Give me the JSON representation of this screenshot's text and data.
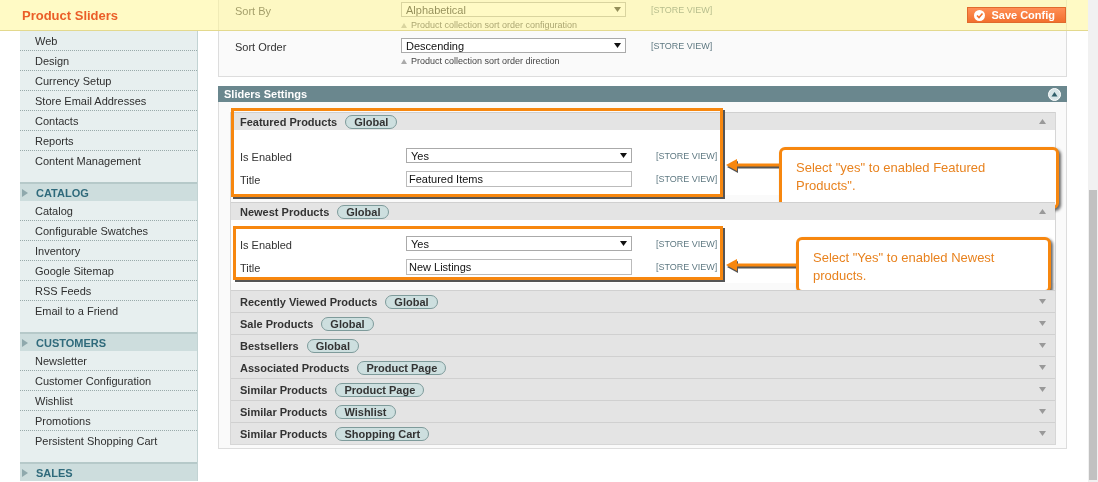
{
  "header": {
    "title": "Product Sliders",
    "save_button": "Save Config"
  },
  "sidebar": {
    "groups": [
      {
        "items": [
          "Web",
          "Design",
          "Currency Setup",
          "Store Email Addresses",
          "Contacts",
          "Reports",
          "Content Management"
        ]
      },
      {
        "title": "CATALOG",
        "items": [
          "Catalog",
          "Configurable Swatches",
          "Inventory",
          "Google Sitemap",
          "RSS Feeds",
          "Email to a Friend"
        ]
      },
      {
        "title": "CUSTOMERS",
        "items": [
          "Newsletter",
          "Customer Configuration",
          "Wishlist",
          "Promotions",
          "Persistent Shopping Cart"
        ]
      },
      {
        "title": "SALES"
      }
    ]
  },
  "general_fields": [
    {
      "label": "Sort By",
      "value": "Alphabetical",
      "note": "Product collection sort order configuration",
      "scope": "[STORE VIEW]"
    },
    {
      "label": "Sort Order",
      "value": "Descending",
      "note": "Product collection sort order direction",
      "scope": "[STORE VIEW]"
    }
  ],
  "sliders_section": {
    "title": "Sliders Settings",
    "expanded": true,
    "groups": [
      {
        "title": "Featured Products",
        "scope": "Global",
        "expanded": true,
        "fields": [
          {
            "kind": "select",
            "label": "Is Enabled",
            "value": "Yes",
            "scope": "[STORE VIEW]"
          },
          {
            "kind": "text",
            "label": "Title",
            "value": "Featured Items",
            "scope": "[STORE VIEW]"
          }
        ],
        "annotation": {
          "kind": "group",
          "text": "Select \"yes\" to enabled Featured Products\"."
        }
      },
      {
        "title": "Newest Products",
        "scope": "Global",
        "expanded": true,
        "fields": [
          {
            "kind": "select",
            "label": "Is Enabled",
            "value": "Yes",
            "scope": "[STORE VIEW]"
          },
          {
            "kind": "text",
            "label": "Title",
            "value": "New Listings",
            "scope": "[STORE VIEW]"
          }
        ],
        "annotation": {
          "kind": "fields",
          "text": "Select \"Yes\" to enabled Newest products."
        }
      },
      {
        "title": "Recently Viewed Products",
        "scope": "Global",
        "expanded": false
      },
      {
        "title": "Sale Products",
        "scope": "Global",
        "expanded": false
      },
      {
        "title": "Bestsellers",
        "scope": "Global",
        "expanded": false
      },
      {
        "title": "Associated Products",
        "scope": "Product Page",
        "expanded": false
      },
      {
        "title": "Similar Products",
        "scope": "Product Page",
        "expanded": false
      },
      {
        "title": "Similar Products",
        "scope": "Wishlist",
        "expanded": false
      },
      {
        "title": "Similar Products",
        "scope": "Shopping Cart",
        "expanded": false
      }
    ]
  }
}
